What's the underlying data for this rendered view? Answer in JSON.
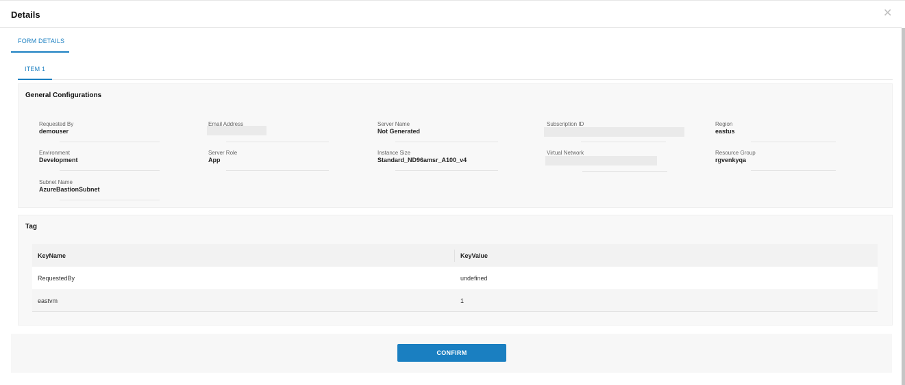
{
  "dialog": {
    "title": "Details",
    "close_glyph": "✕"
  },
  "tabs": {
    "form_details": "FORM DETAILS",
    "item1": "ITEM 1"
  },
  "general": {
    "title": "General Configurations",
    "fields": {
      "requested_by": {
        "label": "Requested By",
        "value": "demouser"
      },
      "email": {
        "label": "Email Address",
        "value": ""
      },
      "server_name": {
        "label": "Server Name",
        "value": "Not Generated"
      },
      "subscription": {
        "label": "Subscription ID",
        "value": ""
      },
      "region": {
        "label": "Region",
        "value": "eastus"
      },
      "environment": {
        "label": "Environment",
        "value": "Development"
      },
      "server_role": {
        "label": "Server Role",
        "value": "App"
      },
      "instance_size": {
        "label": "Instance Size",
        "value": "Standard_ND96amsr_A100_v4"
      },
      "virtual_network": {
        "label": "Virtual Network",
        "value": ""
      },
      "resource_group": {
        "label": "Resource Group",
        "value": "rgvenkyqa"
      },
      "subnet": {
        "label": "Subnet Name",
        "value": "AzureBastionSubnet"
      }
    }
  },
  "tag": {
    "title": "Tag",
    "columns": {
      "key": "KeyName",
      "value": "KeyValue"
    },
    "rows": [
      {
        "key": "RequestedBy",
        "value": "undefined"
      },
      {
        "key": "eastvm",
        "value": "1"
      }
    ]
  },
  "footer": {
    "confirm_label": "CONFIRM"
  },
  "colors": {
    "accent": "#1a7fc1"
  }
}
